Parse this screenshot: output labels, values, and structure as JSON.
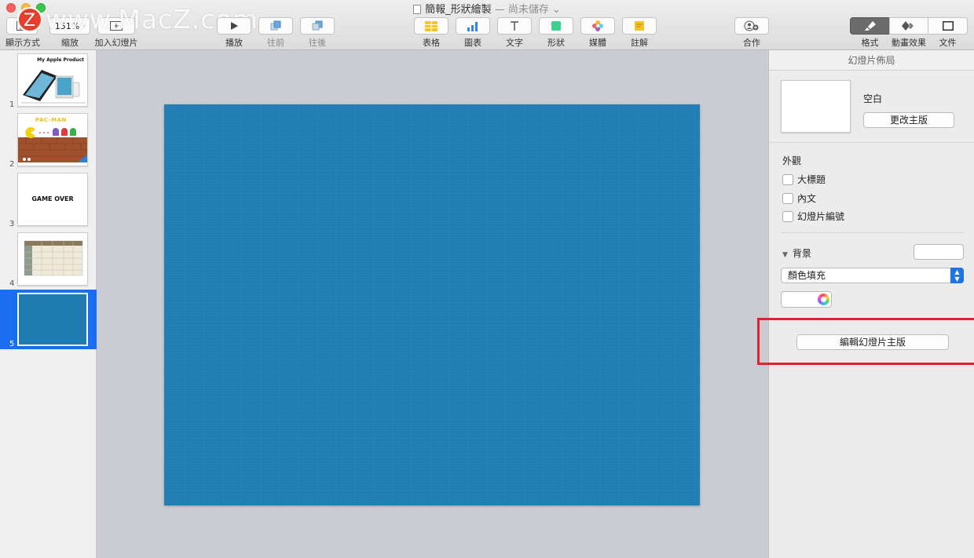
{
  "window": {
    "title": "簡報_形狀繪製",
    "subtitle": "— 尚未儲存 ⌄",
    "watermark": "www.MacZ.com",
    "watermark_logo": "Z"
  },
  "toolbar": {
    "view_label": "顯示方式",
    "zoom_value": "151%",
    "zoom_label": "縮放",
    "add_slide_label": "加入幻燈片",
    "play_label": "播放",
    "forward_label": "往前",
    "backward_label": "往後",
    "table_label": "表格",
    "chart_label": "圖表",
    "text_label": "文字",
    "shape_label": "形狀",
    "media_label": "媒體",
    "comment_label": "註解",
    "collaborate_label": "合作",
    "format_label": "格式",
    "animate_label": "動畫效果",
    "document_label": "文件"
  },
  "navigator": {
    "slides": [
      {
        "number": "1",
        "title": "My Apple Product"
      },
      {
        "number": "2",
        "title": "PAC-MAN"
      },
      {
        "number": "3",
        "title": "GAME OVER"
      },
      {
        "number": "4",
        "title": ""
      },
      {
        "number": "5",
        "title": ""
      }
    ],
    "selected": "5"
  },
  "slide": {
    "background_color": "#1f7db3"
  },
  "inspector": {
    "header": "幻燈片佈局",
    "master_name": "空白",
    "change_master_button": "更改主版",
    "appearance_title": "外觀",
    "title_checkbox": "大標題",
    "body_checkbox": "內文",
    "slide_number_checkbox": "幻燈片編號",
    "background_title": "背景",
    "fill_type": "顏色填充",
    "edit_master_button": "編輯幻燈片主版"
  },
  "colors": {
    "accent": "#1a6ff1",
    "highlight": "#e3222b",
    "slide_blue": "#1f7db3"
  }
}
